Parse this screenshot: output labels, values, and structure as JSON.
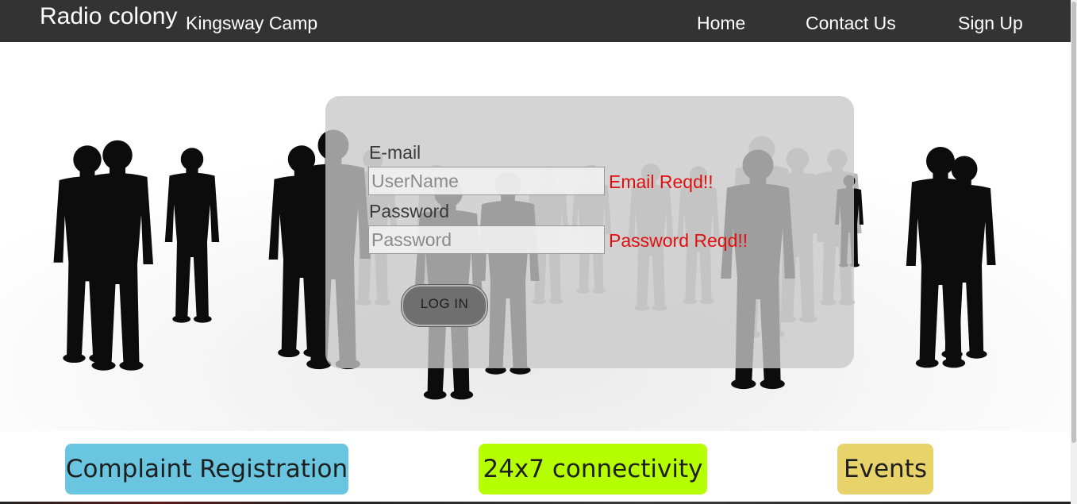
{
  "header": {
    "brand": "Radio colony",
    "subtitle": "Kingsway Camp",
    "nav": {
      "home": "Home",
      "contact": "Contact Us",
      "signup": "Sign Up"
    }
  },
  "login": {
    "email_label": "E-mail",
    "email_placeholder": "UserName",
    "email_value": "",
    "email_error": "Email Reqd!!",
    "password_label": "Password",
    "password_placeholder": "Password",
    "password_value": "",
    "password_error": "Password Reqd!!",
    "submit_label": "LOG IN"
  },
  "features": {
    "complaint": "Complaint Registration",
    "connectivity": "24x7 connectivity",
    "events": "Events"
  },
  "colors": {
    "nav_bg": "#333333",
    "error": "#e01010",
    "complaint_tile": "#6ac6e0",
    "connectivity_tile": "#b6ff00",
    "events_tile": "#e8d36a"
  },
  "icons": {
    "hero": "people-silhouettes-illustration"
  }
}
